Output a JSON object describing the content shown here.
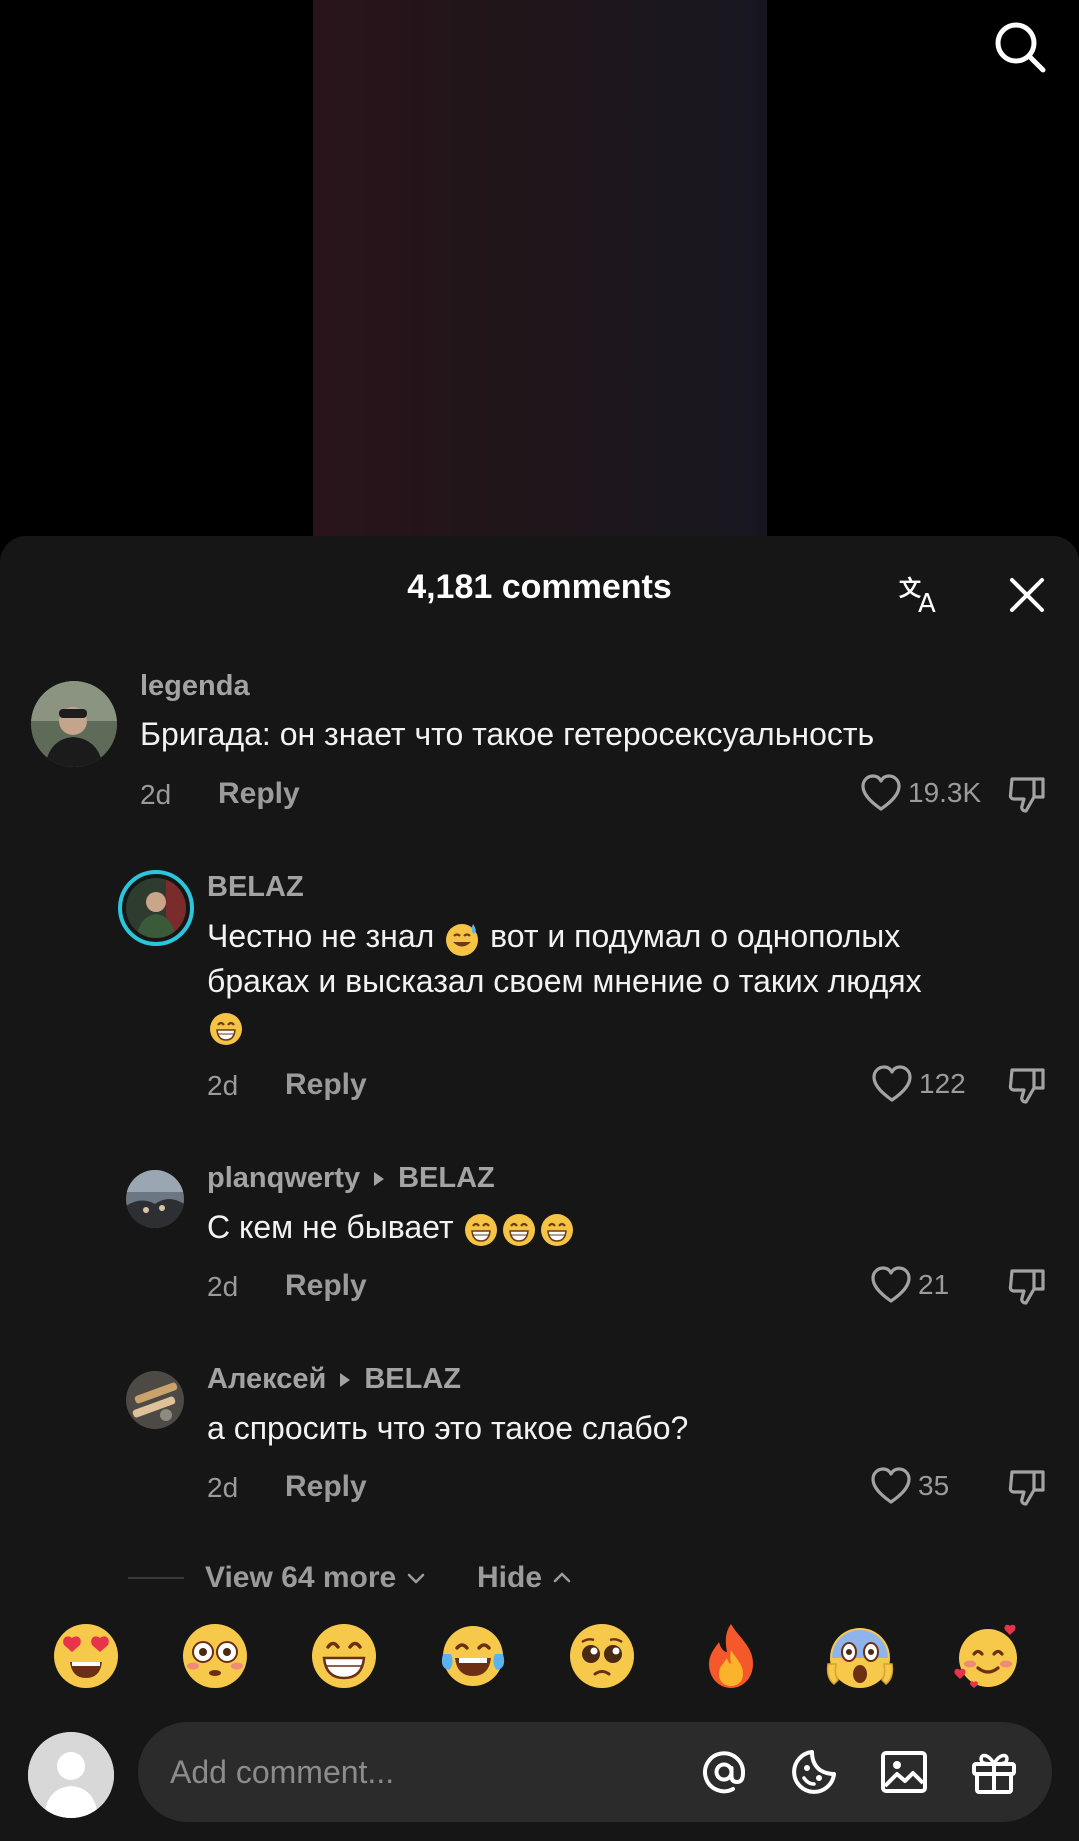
{
  "header": {
    "comment_count_title": "4,181 comments"
  },
  "comments": [
    {
      "author": "legenda",
      "text": "Бригада: он знает что такое гетеросексуальность",
      "time": "2d",
      "reply_label": "Reply",
      "likes": "19.3K"
    },
    {
      "author": "BELAZ",
      "text_line1_a": "Честно не знал",
      "text_line1_b": "вот и подумал о однополых",
      "text_line2": "браках и высказал своем мнение о таких людях",
      "time": "2d",
      "reply_label": "Reply",
      "likes": "122"
    },
    {
      "author": "planqwerty",
      "reply_to": "BELAZ",
      "text": "С кем не бывает",
      "time": "2d",
      "reply_label": "Reply",
      "likes": "21"
    },
    {
      "author": "Алексей",
      "reply_to": "BELAZ",
      "text": "а спросить что это такое слабо?",
      "time": "2d",
      "reply_label": "Reply",
      "likes": "35"
    }
  ],
  "thread": {
    "view_more_label": "View 64 more",
    "hide_label": "Hide"
  },
  "emoji_bar": [
    "heart-eyes",
    "flushed",
    "grin",
    "tears-of-joy",
    "pleading",
    "fire",
    "scream",
    "smiling-hearts"
  ],
  "composer": {
    "placeholder": "Add comment..."
  },
  "colors": {
    "sheet_bg": "#161616",
    "input_bg": "#2b2b2b",
    "muted_text": "#9b9b9b",
    "story_ring": "#29c6dc"
  }
}
